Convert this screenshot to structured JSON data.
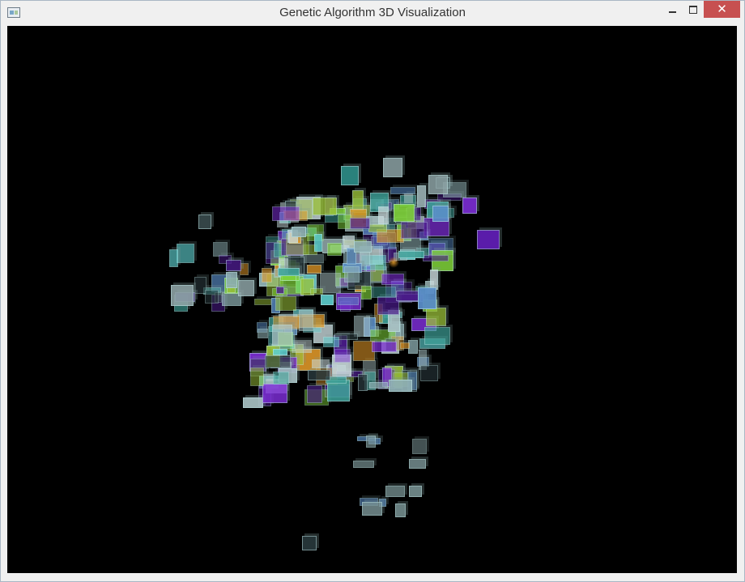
{
  "window": {
    "title": "Genetic Algorithm 3D Visualization",
    "close_symbol": "✕"
  },
  "colors": {
    "viewport_bg": "#000000",
    "titlebar_bg": "#f0f0f0",
    "close_button": "#c75050",
    "cube_palette": [
      "#3fa39a",
      "#8fb0b4",
      "#a9c2c4",
      "#5fd0d0",
      "#7d2ed6",
      "#4a1c8a",
      "#7fd23a",
      "#9bc23a",
      "#5a8ec8",
      "#2a3a3e",
      "#c8d8da",
      "#e39a2a"
    ]
  },
  "icons": {
    "app": "app-window-icon",
    "minimize": "minimize-icon",
    "maximize": "maximize-icon",
    "close": "close-icon"
  }
}
